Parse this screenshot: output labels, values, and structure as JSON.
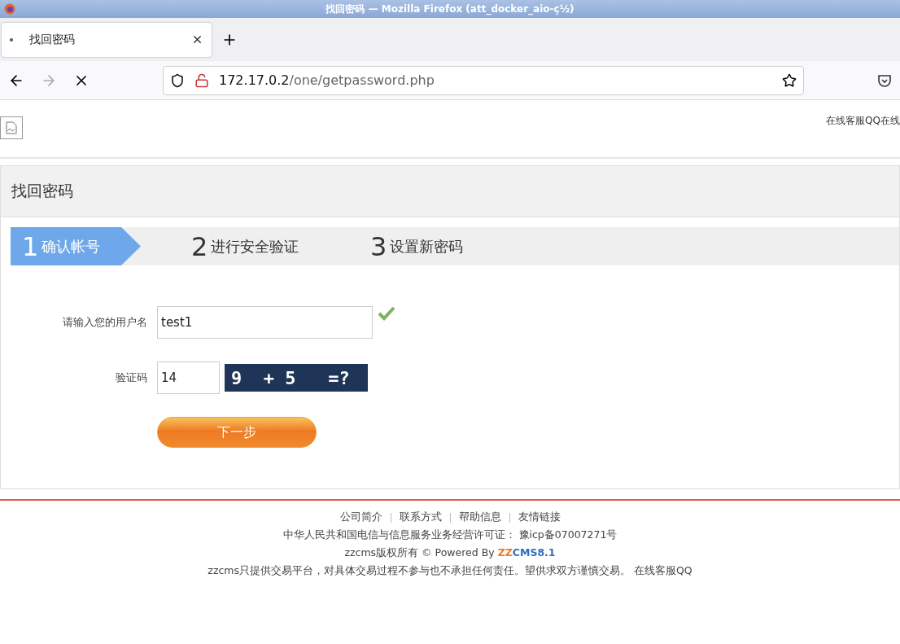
{
  "window": {
    "title": "找回密码 — Mozilla Firefox (att_docker_aio-ç½)"
  },
  "tabs": [
    {
      "label": "找回密码",
      "selected": true,
      "loading": true
    }
  ],
  "address_bar": {
    "host": "172.17.0.2",
    "path": "/one/getpassword.php"
  },
  "header": {
    "service_text": "在线客服QQ在线"
  },
  "panel": {
    "title": "找回密码",
    "steps": [
      {
        "number": "1",
        "label": "确认帐号",
        "selected": true
      },
      {
        "number": "2",
        "label": "进行安全验证",
        "selected": false
      },
      {
        "number": "3",
        "label": "设置新密码",
        "selected": false
      }
    ],
    "form": {
      "username": {
        "label": "请输入您的用户名",
        "value": "test1",
        "valid": true
      },
      "captcha": {
        "label": "验证码",
        "value": "14",
        "image_text": "9  + 5   =?"
      },
      "submit": "下一步"
    }
  },
  "footer": {
    "links": [
      "公司简介",
      "联系方式",
      "帮助信息",
      "友情链接"
    ],
    "license": "中华人民共和国电信与信息服务业务经营许可证： 豫icp备07007271号",
    "copyright": "zzcms版权所有 © Powered By",
    "brand_first": "ZZ",
    "brand_second": "CMS8.1",
    "disclaimer": "zzcms只提供交易平台，对具体交易过程不参与也不承担任何责任。望供求双方谨慎交易。 在线客服QQ"
  }
}
